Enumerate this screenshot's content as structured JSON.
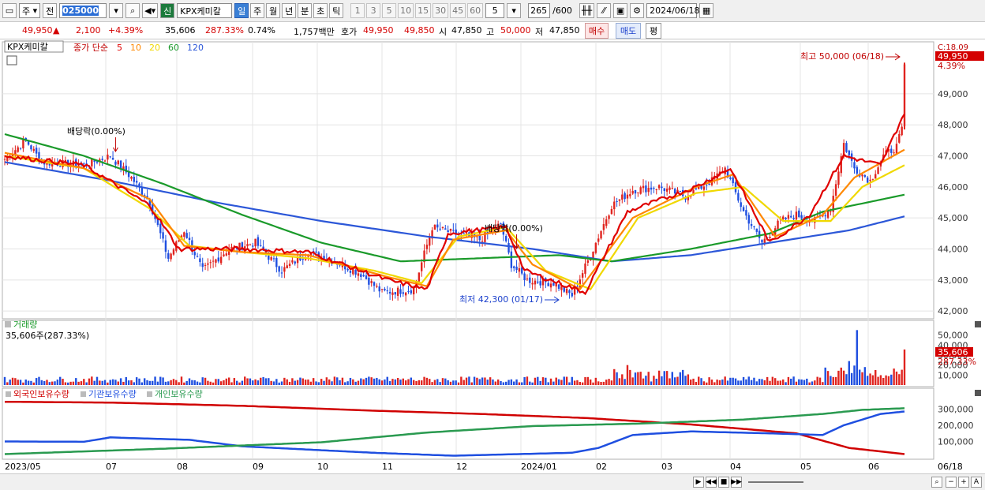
{
  "toolbar": {
    "type_select": "주",
    "prev_label": "전",
    "code": "025000",
    "market_badge": "신",
    "stock_name": "KPX케미칼",
    "periods": [
      "일",
      "주",
      "월",
      "년",
      "분",
      "초",
      "틱"
    ],
    "selected_period": "일",
    "intervals": [
      "1",
      "3",
      "5",
      "10",
      "15",
      "30",
      "45",
      "60"
    ],
    "custom_interval": "5",
    "count": "265",
    "count_max": "/600",
    "date": "2024/06/18"
  },
  "quote": {
    "price": "49,950",
    "arrow": "▲",
    "change": "2,100",
    "change_pct": "+4.39%",
    "volume": "35,606",
    "volume_ratio": "287.33%",
    "turnover": "0.74%",
    "amount": "1,757백만",
    "ask_label": "호가",
    "ask": "49,950",
    "bid": "49,850",
    "open_label": "시",
    "open": "47,850",
    "high_label": "고",
    "high": "50,000",
    "low_label": "저",
    "low": "47,850",
    "buy_label": "매수",
    "sell_label": "매도",
    "avg_label": "평"
  },
  "price_panel": {
    "name": "KPX케미칼",
    "ma_title": "종가 단순",
    "ma_periods": [
      "5",
      "10",
      "20",
      "60",
      "120"
    ],
    "ma_colors": [
      "#e00000",
      "#ff8800",
      "#f0d800",
      "#1a9a2a",
      "#2c57d8"
    ],
    "corner_label": "C:18.09",
    "last_price": "49,950",
    "last_pct": "4.39%",
    "high_note": "최고 50,000 (06/18)",
    "low_note": "최저 42,300 (01/17)",
    "dividend_note": "배당락(0.00%)"
  },
  "volume_panel": {
    "title": "거래량",
    "legend": "35,606주(287.33%)",
    "last": "35,606",
    "last_pct": "287.33%"
  },
  "holding_panel": {
    "series": [
      "외국인보유수량",
      "기관보유수량",
      "개인보유수량"
    ],
    "colors": [
      "#d00000",
      "#1f4fe0",
      "#2a9a50"
    ]
  },
  "x_labels": [
    "2023/05",
    "07",
    "08",
    "09",
    "10",
    "11",
    "12",
    "2024/01",
    "02",
    "03",
    "04",
    "05",
    "06",
    "06/18"
  ],
  "chart_data": {
    "type": "candlestick",
    "y_price_ticks": [
      42000,
      43000,
      44000,
      45000,
      46000,
      47000,
      48000,
      49000
    ],
    "price_range": [
      41800,
      50600
    ],
    "volume_ticks": [
      10000,
      20000,
      30000,
      40000,
      50000
    ],
    "volume_range": [
      0,
      60000
    ],
    "holding_ticks": [
      100000,
      200000,
      300000
    ],
    "holding_range": [
      0,
      380000
    ],
    "ohlc_anchors": [
      {
        "i": 0,
        "c": 46900
      },
      {
        "i": 8,
        "c": 47500
      },
      {
        "i": 14,
        "c": 46800
      },
      {
        "i": 30,
        "c": 46700
      },
      {
        "i": 40,
        "c": 47000
      },
      {
        "i": 48,
        "c": 46300
      },
      {
        "i": 55,
        "c": 45500
      },
      {
        "i": 62,
        "c": 43700
      },
      {
        "i": 68,
        "c": 44600
      },
      {
        "i": 75,
        "c": 43300
      },
      {
        "i": 85,
        "c": 44000
      },
      {
        "i": 95,
        "c": 44200
      },
      {
        "i": 105,
        "c": 43300
      },
      {
        "i": 115,
        "c": 43900
      },
      {
        "i": 125,
        "c": 43600
      },
      {
        "i": 135,
        "c": 43200
      },
      {
        "i": 143,
        "c": 42600
      },
      {
        "i": 155,
        "c": 42700
      },
      {
        "i": 162,
        "c": 44700
      },
      {
        "i": 170,
        "c": 44500
      },
      {
        "i": 180,
        "c": 44300
      },
      {
        "i": 188,
        "c": 44800
      },
      {
        "i": 192,
        "c": 43500
      },
      {
        "i": 198,
        "c": 43000
      },
      {
        "i": 208,
        "c": 42900
      },
      {
        "i": 215,
        "c": 42500
      },
      {
        "i": 222,
        "c": 43800
      },
      {
        "i": 230,
        "c": 45400
      },
      {
        "i": 238,
        "c": 45900
      },
      {
        "i": 248,
        "c": 46000
      },
      {
        "i": 258,
        "c": 45700
      },
      {
        "i": 268,
        "c": 46200
      },
      {
        "i": 273,
        "c": 46600
      },
      {
        "i": 280,
        "c": 45200
      },
      {
        "i": 287,
        "c": 44200
      },
      {
        "i": 294,
        "c": 44900
      },
      {
        "i": 300,
        "c": 45100
      },
      {
        "i": 307,
        "c": 44900
      },
      {
        "i": 313,
        "c": 45300
      },
      {
        "i": 318,
        "c": 47400
      },
      {
        "i": 322,
        "c": 46600
      },
      {
        "i": 328,
        "c": 46200
      },
      {
        "i": 333,
        "c": 47000
      },
      {
        "i": 338,
        "c": 47300
      },
      {
        "i": 340,
        "c": 47850
      },
      {
        "i": 341,
        "c": 49950
      }
    ],
    "ma_anchors": {
      "ma120": [
        [
          0,
          46800
        ],
        [
          40,
          46200
        ],
        [
          80,
          45500
        ],
        [
          120,
          44900
        ],
        [
          160,
          44400
        ],
        [
          200,
          44000
        ],
        [
          230,
          43600
        ],
        [
          260,
          43800
        ],
        [
          290,
          44200
        ],
        [
          320,
          44600
        ],
        [
          341,
          45050
        ]
      ],
      "ma60": [
        [
          0,
          47700
        ],
        [
          30,
          47000
        ],
        [
          60,
          46100
        ],
        [
          90,
          45100
        ],
        [
          120,
          44200
        ],
        [
          150,
          43600
        ],
        [
          180,
          43700
        ],
        [
          210,
          43800
        ],
        [
          230,
          43600
        ],
        [
          260,
          44000
        ],
        [
          290,
          44500
        ],
        [
          310,
          45200
        ],
        [
          341,
          45750
        ]
      ],
      "ma20": [
        [
          0,
          47000
        ],
        [
          30,
          46600
        ],
        [
          55,
          45300
        ],
        [
          70,
          44100
        ],
        [
          90,
          43900
        ],
        [
          115,
          43700
        ],
        [
          140,
          43300
        ],
        [
          158,
          42900
        ],
        [
          172,
          44400
        ],
        [
          190,
          44700
        ],
        [
          205,
          43300
        ],
        [
          222,
          42700
        ],
        [
          240,
          45000
        ],
        [
          262,
          45800
        ],
        [
          280,
          46000
        ],
        [
          295,
          44900
        ],
        [
          313,
          44900
        ],
        [
          325,
          46000
        ],
        [
          341,
          46700
        ]
      ],
      "ma10": [
        [
          0,
          47100
        ],
        [
          30,
          46600
        ],
        [
          55,
          45600
        ],
        [
          68,
          44100
        ],
        [
          90,
          43900
        ],
        [
          115,
          43800
        ],
        [
          145,
          43100
        ],
        [
          160,
          42800
        ],
        [
          170,
          44300
        ],
        [
          190,
          44600
        ],
        [
          200,
          43500
        ],
        [
          218,
          42700
        ],
        [
          238,
          45000
        ],
        [
          262,
          46000
        ],
        [
          276,
          46400
        ],
        [
          292,
          44400
        ],
        [
          310,
          45100
        ],
        [
          322,
          46300
        ],
        [
          341,
          47200
        ]
      ],
      "ma5": [
        [
          0,
          47000
        ],
        [
          30,
          46700
        ],
        [
          55,
          45400
        ],
        [
          66,
          44000
        ],
        [
          90,
          44000
        ],
        [
          115,
          43900
        ],
        [
          145,
          43000
        ],
        [
          160,
          42700
        ],
        [
          168,
          44500
        ],
        [
          190,
          44700
        ],
        [
          197,
          43300
        ],
        [
          220,
          42600
        ],
        [
          236,
          45200
        ],
        [
          262,
          46000
        ],
        [
          275,
          46600
        ],
        [
          290,
          44200
        ],
        [
          305,
          45100
        ],
        [
          318,
          47000
        ],
        [
          332,
          46700
        ],
        [
          341,
          48400
        ]
      ]
    },
    "holding_anchors": {
      "foreign": [
        [
          0,
          345000
        ],
        [
          40,
          340000
        ],
        [
          90,
          320000
        ],
        [
          140,
          290000
        ],
        [
          180,
          270000
        ],
        [
          220,
          245000
        ],
        [
          260,
          205000
        ],
        [
          300,
          150000
        ],
        [
          320,
          60000
        ],
        [
          341,
          22000
        ]
      ],
      "institution": [
        [
          0,
          100000
        ],
        [
          30,
          98000
        ],
        [
          40,
          125000
        ],
        [
          70,
          110000
        ],
        [
          90,
          70000
        ],
        [
          140,
          30000
        ],
        [
          170,
          12000
        ],
        [
          215,
          30000
        ],
        [
          225,
          60000
        ],
        [
          238,
          140000
        ],
        [
          260,
          162000
        ],
        [
          290,
          150000
        ],
        [
          310,
          140000
        ],
        [
          318,
          200000
        ],
        [
          332,
          270000
        ],
        [
          341,
          285000
        ]
      ],
      "individual": [
        [
          0,
          22000
        ],
        [
          60,
          55000
        ],
        [
          120,
          95000
        ],
        [
          160,
          155000
        ],
        [
          200,
          195000
        ],
        [
          240,
          210000
        ],
        [
          280,
          235000
        ],
        [
          310,
          270000
        ],
        [
          325,
          295000
        ],
        [
          341,
          305000
        ]
      ]
    },
    "dividend_events": [
      42,
      194
    ],
    "high_point": {
      "i": 341,
      "value": 50000
    },
    "low_point": {
      "i": 215,
      "value": 42300
    }
  }
}
